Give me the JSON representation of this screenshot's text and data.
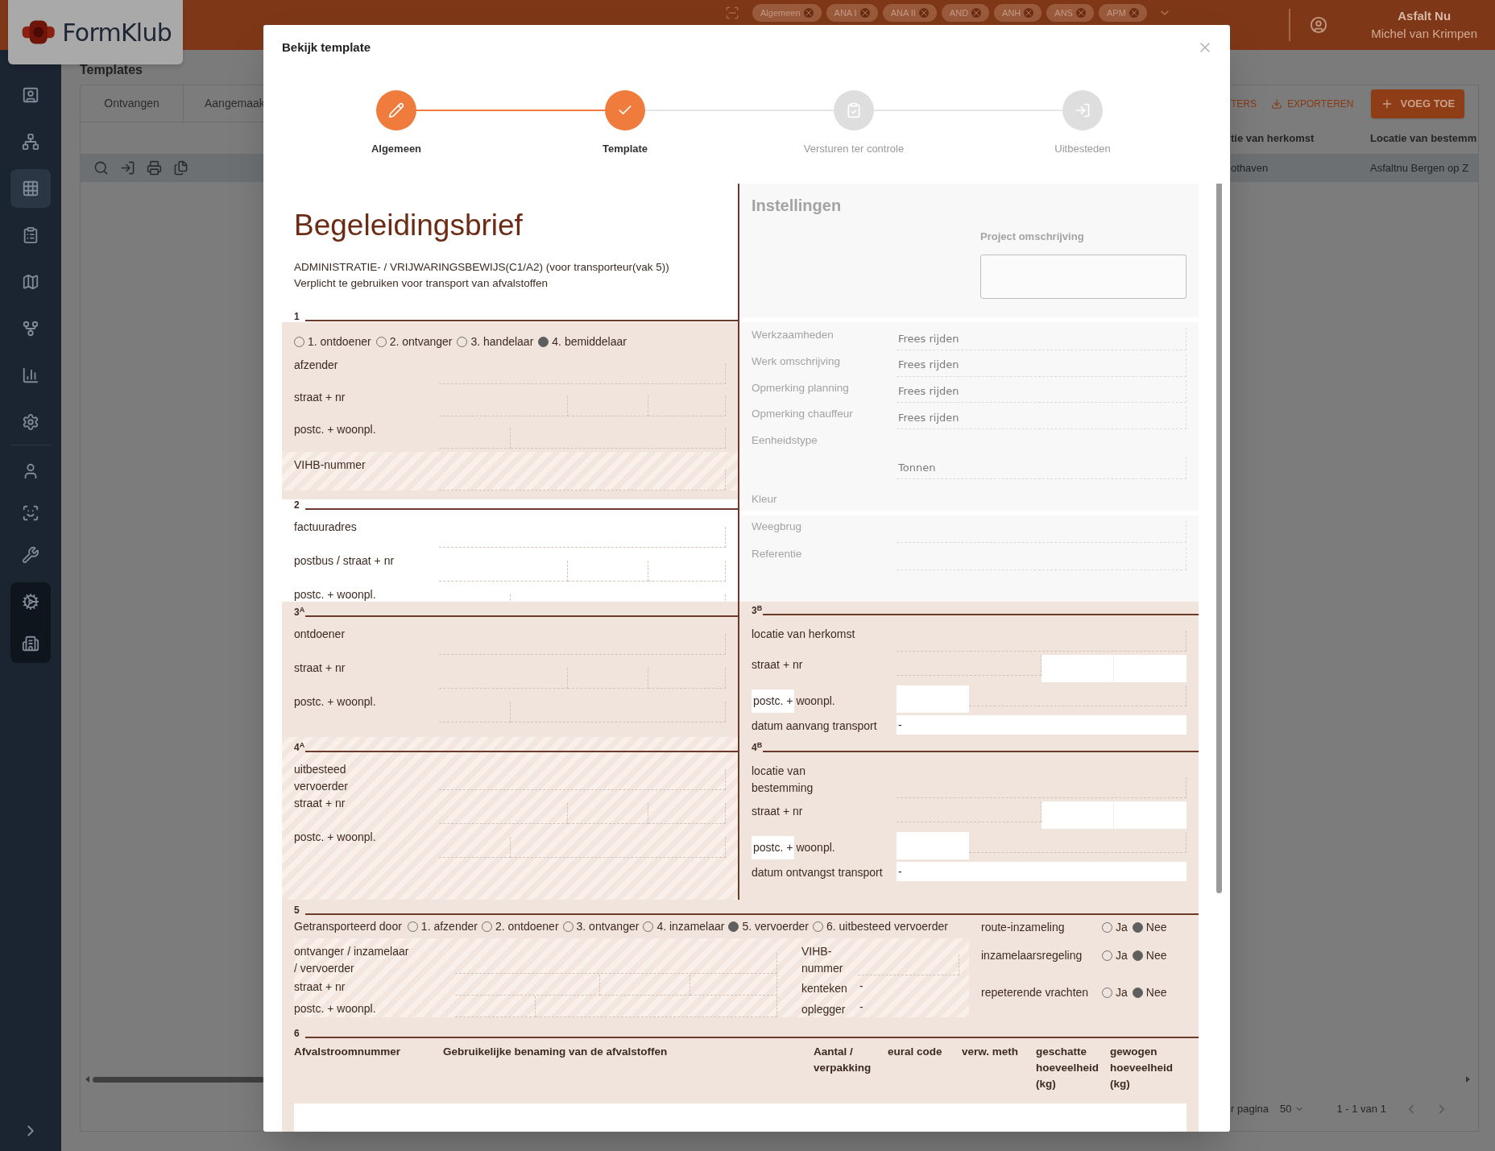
{
  "topbar": {
    "logo": "FormKlub",
    "chips": [
      "Algemeen",
      "ANA I",
      "ANA II",
      "AND",
      "ANH",
      "ANS",
      "APM"
    ],
    "user": {
      "name": "Asfalt Nu",
      "subtitle": "Michel van Krimpen"
    }
  },
  "sidebar": {
    "groups": [
      {
        "kind": "main",
        "items": [
          {
            "selected": false
          },
          {
            "selected": false
          },
          {
            "selected": true
          },
          {
            "selected": false
          },
          {
            "selected": false
          },
          {
            "selected": false
          },
          {
            "selected": false
          },
          {
            "selected": false
          }
        ]
      },
      {
        "kind": "user",
        "items": [
          {
            "selected": false
          },
          {
            "selected": false
          },
          {
            "selected": false
          }
        ]
      },
      {
        "kind": "admin",
        "items": [
          {
            "selected": false
          },
          {
            "selected": false
          }
        ]
      }
    ]
  },
  "page": {
    "title": "Templates",
    "tabs": [
      {
        "label": "Ontvangen",
        "selected": false
      },
      {
        "label": "Aangemaak",
        "selected": false
      }
    ],
    "actions": {
      "filters": "TERS",
      "export": "EXPORTEREN",
      "add": "VOEG TOE"
    },
    "table": {
      "columns": [
        "tie van herkomst",
        "Locatie van bestemm"
      ],
      "rows": [
        [
          "othaven",
          "Asfaltnu Bergen op Z"
        ]
      ]
    },
    "pagination": {
      "per_page_label": "r pagina",
      "per_page": "50",
      "range": "1 - 1 van 1"
    }
  },
  "modal": {
    "title": "Bekijk template",
    "steps": [
      {
        "label": "Algemeen",
        "done": true
      },
      {
        "label": "Template",
        "done": true
      },
      {
        "label": "Versturen ter controle",
        "done": false
      },
      {
        "label": "Uitbesteden",
        "done": false
      }
    ],
    "form": {
      "title": "Begeleidingsbrief",
      "subtitle_lines": [
        "ADMINISTRATIE- / VRIJWARINGSBEWIJS(C1/A2) (voor transporteur(vak 5))",
        "Verplicht te gebruiken voor transport van afvalstoffen"
      ],
      "settings": {
        "title": "Instellingen",
        "project_label": "Project omschrijving",
        "rows": [
          {
            "label": "Werkzaamheden",
            "kind": "single",
            "value": "Frees rijden"
          },
          {
            "label": "Werk omschrijving",
            "kind": "single",
            "value": "Frees rijden"
          },
          {
            "label": "Opmerking planning",
            "kind": "single",
            "value": "Frees rijden"
          },
          {
            "label": "Opmerking chauffeur",
            "kind": "single",
            "value": "Frees rijden"
          },
          {
            "label": "Eenheidstype",
            "kind": "stacked",
            "value": "Tonnen"
          },
          {
            "label": "Kleur",
            "kind": "label"
          }
        ],
        "rows2": [
          {
            "label": "Weegbrug",
            "kind": "single"
          },
          {
            "label": "Referentie",
            "kind": "single"
          }
        ]
      },
      "section1": {
        "number": "1",
        "roles": [
          {
            "label": "1. ontdoener",
            "selected": false
          },
          {
            "label": "2. ontvanger",
            "selected": false
          },
          {
            "label": "3. handelaar",
            "selected": false
          },
          {
            "label": "4. bemiddelaar",
            "selected": true
          }
        ],
        "fields": [
          {
            "label": "afzender",
            "kind": "single"
          },
          {
            "label": "straat + nr",
            "kind": "triple"
          },
          {
            "label": "postc. + woonpl.",
            "kind": "double"
          },
          {
            "label": "VIHB-nummer",
            "kind": "single",
            "hatched": true
          }
        ]
      },
      "section2": {
        "number": "2",
        "fields": [
          {
            "label": "factuuradres",
            "kind": "single"
          },
          {
            "label": "postbus / straat + nr",
            "kind": "triple"
          },
          {
            "label": "postc. + woonpl.",
            "kind": "double"
          }
        ]
      },
      "section3a": {
        "number": "3$^{A}$",
        "fields": [
          {
            "label": "ontdoener",
            "kind": "single"
          },
          {
            "label": "straat + nr",
            "kind": "triple"
          },
          {
            "label": "postc. + woonpl.",
            "kind": "double"
          }
        ]
      },
      "section3b": {
        "number": "3$^{B}$",
        "fields": [
          {
            "label": "locatie van herkomst",
            "kind": "single"
          },
          {
            "label": "straat + nr",
            "kind": "address"
          },
          {
            "label": "postc. +",
            "label2": "woonpl.",
            "kind": "postal"
          },
          {
            "label": "datum aanvang transport",
            "kind": "value",
            "value": "-"
          }
        ]
      },
      "section4a": {
        "number": "4$^{A}$",
        "hatched": true,
        "fields": [
          {
            "label": "uitbesteed\nvervoerder",
            "kind": "single"
          },
          {
            "label": "straat + nr",
            "kind": "triple"
          },
          {
            "label": "postc. + woonpl.",
            "kind": "double"
          }
        ]
      },
      "section4b": {
        "number": "4$^{B}$",
        "fields": [
          {
            "label": "locatie van\nbestemming",
            "kind": "single"
          },
          {
            "label": "straat + nr",
            "kind": "address"
          },
          {
            "label": "postc. +",
            "label2": "woonpl.",
            "kind": "postal"
          },
          {
            "label": "datum ontvangst transport",
            "kind": "value",
            "value": "-"
          }
        ]
      },
      "section5": {
        "number": "5",
        "transported_label": "Getransporteerd door",
        "options": [
          {
            "label": "1. afzender",
            "selected": false
          },
          {
            "label": "2. ontdoener",
            "selected": false
          },
          {
            "label": "3. ontvanger",
            "selected": false
          },
          {
            "label": "4. inzamelaar",
            "selected": false
          },
          {
            "label": "5. vervoerder",
            "selected": true
          },
          {
            "label": "6. uitbesteed vervoerder",
            "selected": false
          }
        ],
        "fields": [
          {
            "label": "ontvanger / inzamelaar\n/ vervoerder",
            "kind": "single"
          },
          {
            "label": "straat + nr",
            "kind": "triple"
          },
          {
            "label": "postc. + woonpl.",
            "kind": "double"
          }
        ],
        "vehicle": [
          {
            "label": "VIHB-\nnummer",
            "kind": "single"
          },
          {
            "label": "kenteken",
            "kind": "value",
            "value": "-"
          },
          {
            "label": "oplegger",
            "kind": "value",
            "value": "-"
          }
        ],
        "toggles": [
          {
            "label": "route-inzameling",
            "options": [
              {
                "label": "Ja",
                "selected": false
              },
              {
                "label": "Nee",
                "selected": true
              }
            ]
          },
          {
            "label": "inzamelaarsregeling",
            "options": [
              {
                "label": "Ja",
                "selected": false
              },
              {
                "label": "Nee",
                "selected": true
              }
            ]
          },
          {
            "label": "repeterende vrachten",
            "options": [
              {
                "label": "Ja",
                "selected": false
              },
              {
                "label": "Nee",
                "selected": true
              }
            ]
          }
        ]
      },
      "section6": {
        "number": "6",
        "columns": [
          "Afvalstroomnummer",
          "Gebruikelijke benaming van de afvalstoffen",
          "Aantal /\nverpakking",
          "eural code",
          "verw. meth",
          "geschatte\nhoeveelheid\n(kg)",
          "gewogen\nhoeveelheid\n(kg)"
        ]
      }
    }
  }
}
